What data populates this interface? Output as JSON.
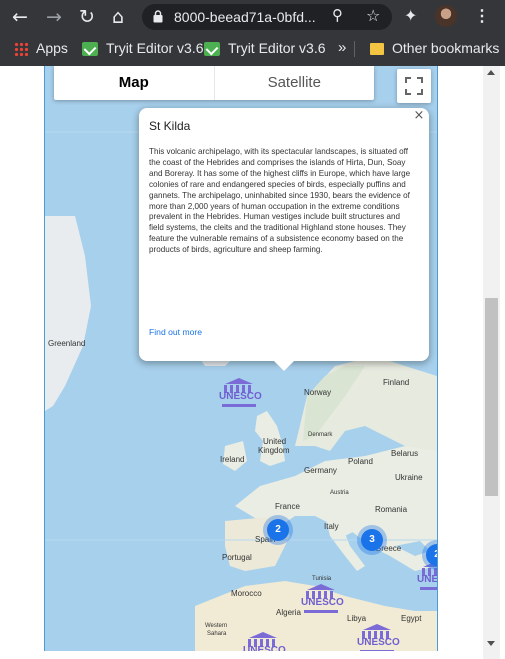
{
  "browser": {
    "url": "8000-beead71a-0bfd...",
    "bookmarks": {
      "apps": "Apps",
      "tryit1": "Tryit Editor v3.6",
      "tryit2": "Tryit Editor v3.6",
      "more": "»",
      "other": "Other bookmarks"
    }
  },
  "map": {
    "map_type": {
      "map": "Map",
      "satellite": "Satellite"
    },
    "labels": {
      "greenland": "Greenland",
      "finland": "Finland",
      "norway": "Norway",
      "denmark": "Denmark",
      "uk1": "United",
      "uk2": "Kingdom",
      "ireland": "Ireland",
      "poland": "Poland",
      "belarus": "Belarus",
      "germany": "Germany",
      "ukraine": "Ukraine",
      "austria": "Austria",
      "france": "France",
      "romania": "Romania",
      "italy": "Italy",
      "spain": "Spain",
      "greece": "Greece",
      "portugal": "Portugal",
      "tunisia": "Tunisia",
      "morocco": "Morocco",
      "algeria": "Algeria",
      "libya": "Libya",
      "egypt": "Egypt",
      "western": "Western",
      "sahara": "Sahara"
    },
    "clusters": {
      "spain": "2",
      "greece": "3",
      "east": "2"
    },
    "unesco_text": "UNESCO"
  },
  "info_window": {
    "title": "St Kilda",
    "close": "×",
    "description": "This volcanic archipelago, with its spectacular landscapes, is situated off the coast of the Hebrides and comprises the islands of Hirta, Dun, Soay and Boreray. It has some of the highest cliffs in Europe, which have large colonies of rare and endangered species of birds, especially puffins and gannets. The archipelago, uninhabited since 1930, bears the evidence of more than 2,000 years of human occupation in the extreme conditions prevalent in the Hebrides. Human vestiges include built structures and field systems, the cleits and the traditional Highland stone houses. They feature the vulnerable remains of a subsistence economy based on the products of birds, agriculture and sheep farming.",
    "link": "Find out more"
  }
}
